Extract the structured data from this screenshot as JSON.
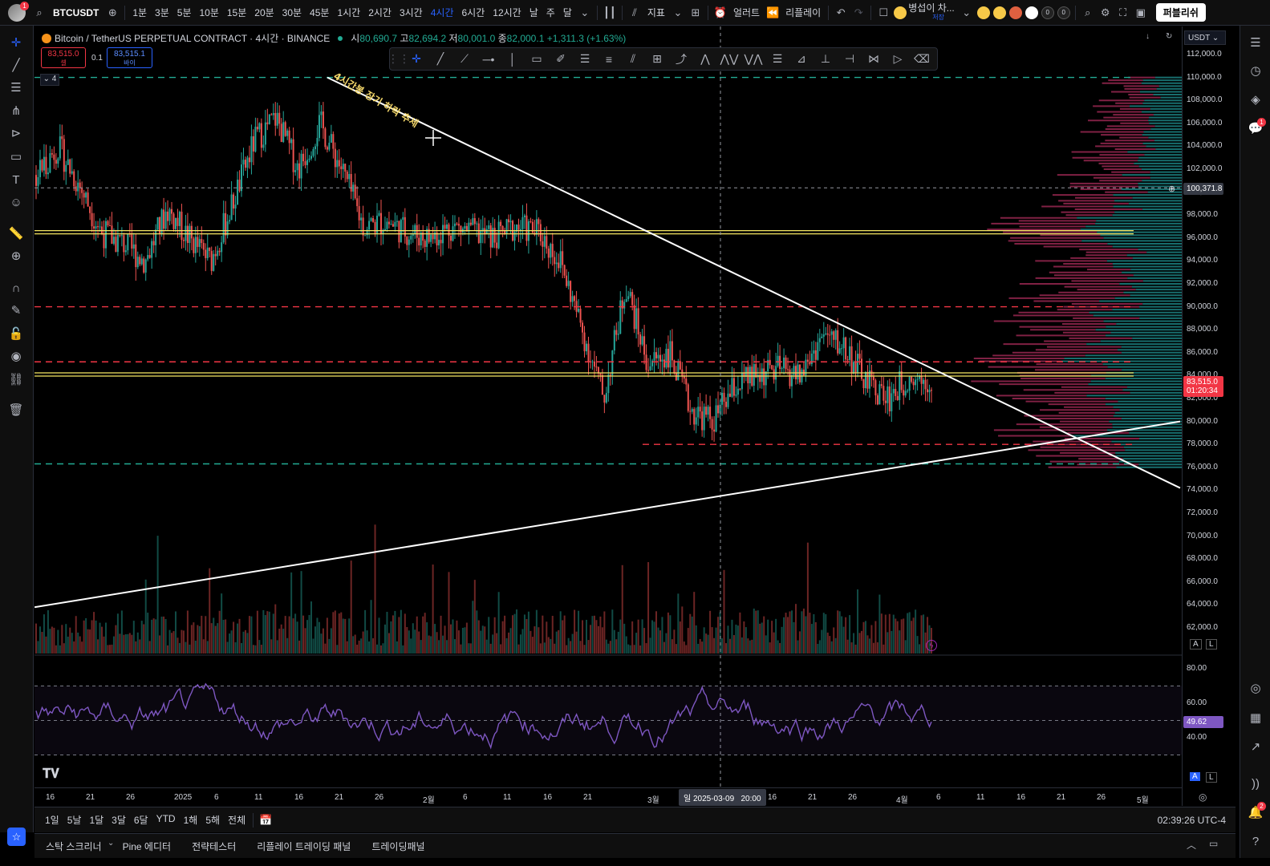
{
  "topbar": {
    "profile_badge": "1",
    "symbol": "BTCUSDT",
    "intervals": [
      "1분",
      "3분",
      "5분",
      "10분",
      "15분",
      "20분",
      "30분",
      "45분",
      "1시간",
      "2시간",
      "3시간",
      "4시간",
      "6시간",
      "12시간",
      "날",
      "주",
      "달"
    ],
    "active_interval": "4시간",
    "indicators_label": "지표",
    "alert_label": "얼러트",
    "replay_label": "리플레이",
    "layout_name": "병섭이 차...",
    "layout_sub": "저장",
    "count_a": "0",
    "count_b": "0",
    "publish_label": "퍼블리쉬"
  },
  "legend": {
    "title": "Bitcoin / TetherUS PERPETUAL CONTRACT · 4시간 · BINANCE",
    "open_k": "시",
    "open": "80,690.7",
    "high_k": "고",
    "high": "82,694.2",
    "low_k": "저",
    "low": "80,001.0",
    "close_k": "종",
    "close": "82,000.1",
    "change": "+1,311.3 (+1.63%)"
  },
  "trade": {
    "sell_price": "83,515.0",
    "sell_label": "셀",
    "spread": "0.1",
    "buy_price": "83,515.1",
    "buy_label": "바이"
  },
  "collapse_count": "4",
  "annotation_text": "4시간봉 장기 하락 추세",
  "price_axis": {
    "currency": "USDT",
    "ticks": [
      "112,000.0",
      "110,000.0",
      "108,000.0",
      "106,000.0",
      "104,000.0",
      "102,000.0",
      "100,000.0",
      "98,000.0",
      "96,000.0",
      "94,000.0",
      "92,000.0",
      "90,000.0",
      "88,000.0",
      "86,000.0",
      "84,000.0",
      "82,000.0",
      "80,000.0",
      "78,000.0",
      "76,000.0",
      "74,000.0",
      "72,000.0",
      "70,000.0",
      "68,000.0",
      "66,000.0",
      "64,000.0",
      "62,000.0"
    ],
    "crosshair_price": "100,371.8",
    "last_price": "83,515.0",
    "countdown": "01:20:34",
    "scale_a": "A",
    "scale_l": "L"
  },
  "rsi": {
    "ticks": [
      "80.00",
      "60.00",
      "40.00"
    ],
    "value": "49.62",
    "upper": 70,
    "lower": 30
  },
  "time_axis": {
    "labels": [
      "16",
      "21",
      "26",
      "2025",
      "6",
      "11",
      "16",
      "21",
      "26",
      "2월",
      "6",
      "11",
      "16",
      "21",
      "3월",
      "16",
      "21",
      "26",
      "4월",
      "6",
      "11",
      "16",
      "21",
      "26",
      "5월"
    ],
    "crosshair_date": "일 2025-03-09",
    "crosshair_time": "20:00"
  },
  "range": {
    "buttons": [
      "1일",
      "5날",
      "1달",
      "3달",
      "6달",
      "YTD",
      "1해",
      "5해",
      "전체"
    ],
    "clock": "02:39:26 UTC-4"
  },
  "bottom": {
    "tabs": [
      "스탁 스크리너",
      "Pine 에디터",
      "전략테스터",
      "리플레이 트레이딩 패널",
      "트레이딩패널"
    ]
  },
  "colors": {
    "up": "#26a69a",
    "down": "#ef5350",
    "accent": "#2962ff",
    "trendline": "#ffffff",
    "horizontal_yellow": "#f5e663",
    "dash_red": "#f23645",
    "dash_green": "#22ab94",
    "rsi_line": "#7e57c2"
  },
  "chart_data": {
    "type": "line",
    "title": "Bitcoin / TetherUS PERPETUAL CONTRACT · 4시간 · BINANCE",
    "series": [
      {
        "values": [
          101500,
          104000,
          100500,
          96500,
          95500,
          94000,
          98500,
          96000,
          94000,
          99000,
          104500,
          106500,
          102000,
          106000,
          102000,
          97000,
          97500,
          96500,
          96000,
          97000,
          96500,
          96000,
          97000,
          96500,
          94000,
          88000,
          82000,
          92000,
          85000,
          86000,
          81000,
          80000,
          83000,
          84000,
          84500,
          84000,
          87500,
          86500,
          83500,
          82000,
          84000,
          83515
        ]
      }
    ],
    "ylim": [
      60000,
      113000
    ],
    "horizontal_levels": [
      110000,
      96500,
      90000,
      85200,
      84100,
      78000,
      76300
    ],
    "rsi_ylim": [
      20,
      90
    ]
  }
}
